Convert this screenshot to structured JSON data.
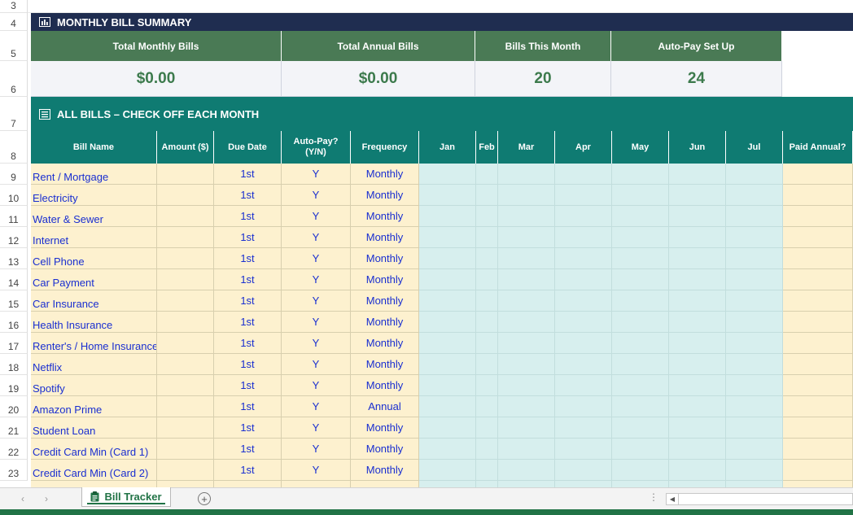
{
  "row_numbers": [
    "3",
    "4",
    "5",
    "6",
    "7",
    "8",
    "9",
    "10",
    "11",
    "12",
    "13",
    "14",
    "15",
    "16",
    "17",
    "18",
    "19",
    "20",
    "21",
    "22",
    "23"
  ],
  "summary": {
    "title": "MONTHLY BILL SUMMARY",
    "icon": "bar-chart-icon",
    "headers": [
      "Total Monthly Bills",
      "Total Annual Bills",
      "Bills This Month",
      "Auto-Pay Set Up"
    ],
    "values": [
      "$0.00",
      "$0.00",
      "20",
      "24"
    ]
  },
  "bills_section": {
    "title": "ALL BILLS – CHECK OFF EACH MONTH",
    "icon": "list-icon",
    "columns": [
      "Bill Name",
      "Amount ($)",
      "Due Date",
      "Auto-Pay?\n(Y/N)",
      "Frequency",
      "Jan",
      "Feb",
      "Mar",
      "Apr",
      "May",
      "Jun",
      "Jul",
      "Paid Annual?"
    ],
    "rows": [
      {
        "name": "Rent / Mortgage",
        "amount": "",
        "due": "1st",
        "autopay": "Y",
        "frequency": "Monthly"
      },
      {
        "name": "Electricity",
        "amount": "",
        "due": "1st",
        "autopay": "Y",
        "frequency": "Monthly"
      },
      {
        "name": "Water & Sewer",
        "amount": "",
        "due": "1st",
        "autopay": "Y",
        "frequency": "Monthly"
      },
      {
        "name": "Internet",
        "amount": "",
        "due": "1st",
        "autopay": "Y",
        "frequency": "Monthly"
      },
      {
        "name": "Cell Phone",
        "amount": "",
        "due": "1st",
        "autopay": "Y",
        "frequency": "Monthly"
      },
      {
        "name": "Car Payment",
        "amount": "",
        "due": "1st",
        "autopay": "Y",
        "frequency": "Monthly"
      },
      {
        "name": "Car Insurance",
        "amount": "",
        "due": "1st",
        "autopay": "Y",
        "frequency": "Monthly"
      },
      {
        "name": "Health Insurance",
        "amount": "",
        "due": "1st",
        "autopay": "Y",
        "frequency": "Monthly"
      },
      {
        "name": "Renter's / Home Insurance",
        "amount": "",
        "due": "1st",
        "autopay": "Y",
        "frequency": "Monthly"
      },
      {
        "name": "Netflix",
        "amount": "",
        "due": "1st",
        "autopay": "Y",
        "frequency": "Monthly"
      },
      {
        "name": "Spotify",
        "amount": "",
        "due": "1st",
        "autopay": "Y",
        "frequency": "Monthly"
      },
      {
        "name": "Amazon Prime",
        "amount": "",
        "due": "1st",
        "autopay": "Y",
        "frequency": "Annual"
      },
      {
        "name": "Student Loan",
        "amount": "",
        "due": "1st",
        "autopay": "Y",
        "frequency": "Monthly"
      },
      {
        "name": "Credit Card Min (Card 1)",
        "amount": "",
        "due": "1st",
        "autopay": "Y",
        "frequency": "Monthly"
      },
      {
        "name": "Credit Card Min (Card 2)",
        "amount": "",
        "due": "1st",
        "autopay": "Y",
        "frequency": "Monthly"
      }
    ]
  },
  "tabs": {
    "active_sheet": "Bill Tracker",
    "active_icon": "clipboard-icon",
    "add_sheet": "+",
    "options": "⋮",
    "scroll_left": "◀"
  },
  "colors": {
    "summary_band": "#1f2d50",
    "bills_band": "#0f7b72",
    "summary_header": "#4a7a55",
    "value_text": "#3c7a4c",
    "cream_fill": "#fdf1cf",
    "month_fill": "#d7efee",
    "data_text": "#1a2fd0",
    "excel_green": "#217346"
  }
}
